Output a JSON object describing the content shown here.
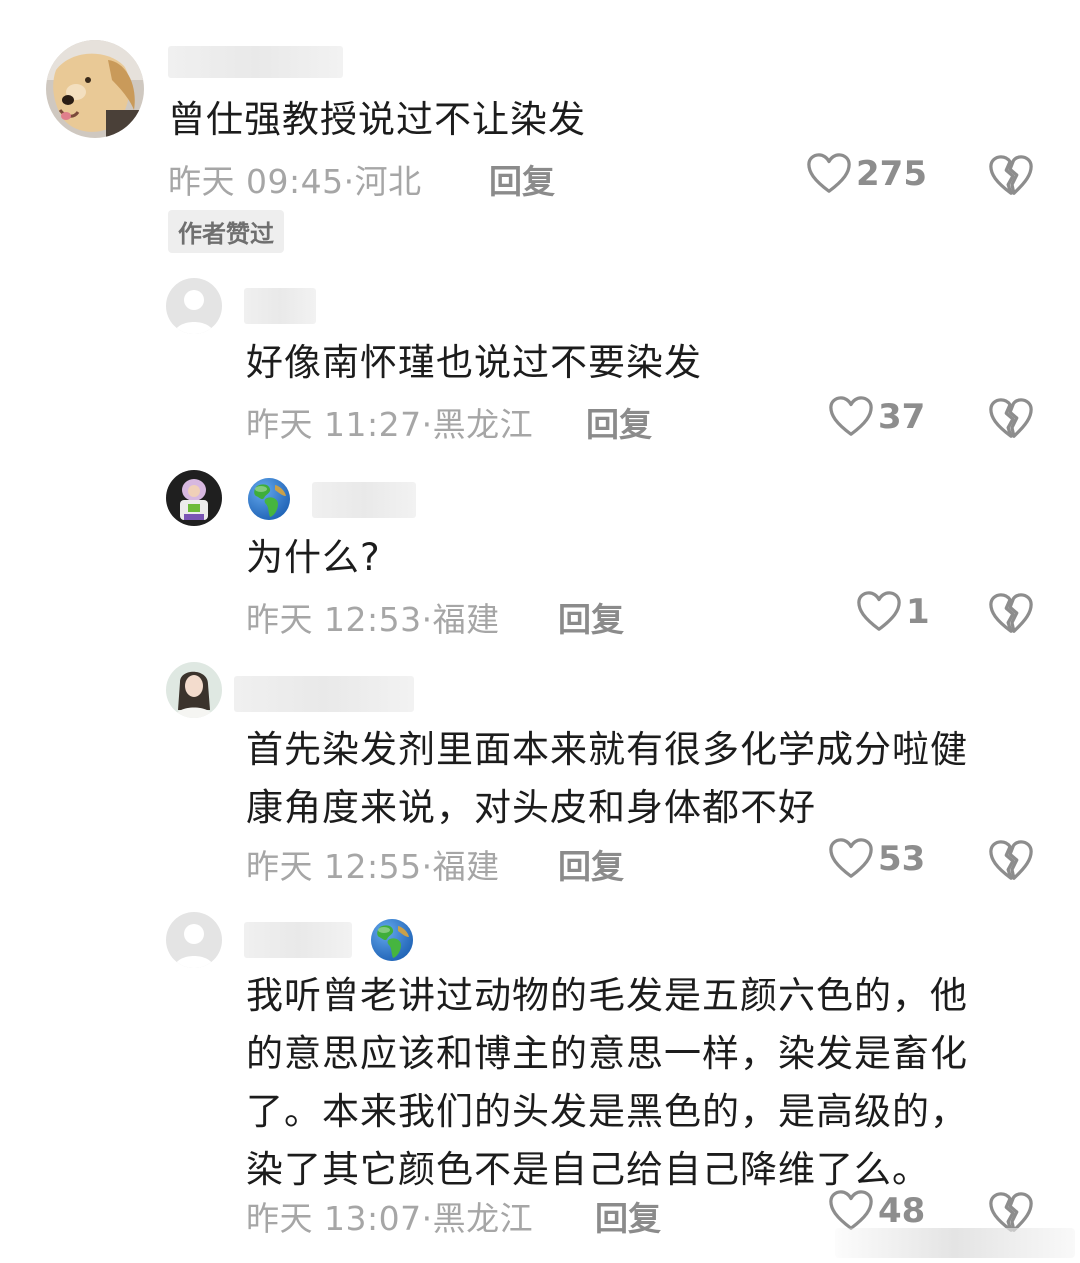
{
  "comments": [
    {
      "content": "曾仕强教授说过不让染发",
      "time": "昨天 09:45",
      "location": "河北",
      "reply_label": "回复",
      "likes": "275",
      "badge": "作者赞过"
    },
    {
      "content": "好像南怀瑾也说过不要染发",
      "time": "昨天 11:27",
      "location": "黑龙江",
      "reply_label": "回复",
      "likes": "37"
    },
    {
      "content": "为什么?",
      "time": "昨天 12:53",
      "location": "福建",
      "reply_label": "回复",
      "likes": "1"
    },
    {
      "content_lines": [
        "首先染发剂里面本来就有很多化学成分啦健",
        "康角度来说，对头皮和身体都不好"
      ],
      "time": "昨天 12:55",
      "location": "福建",
      "reply_label": "回复",
      "likes": "53"
    },
    {
      "content_lines": [
        "我听曾老讲过动物的毛发是五颜六色的，他",
        "的意思应该和博主的意思一样，染发是畜化",
        "了。本来我们的头发是黑色的，是高级的，",
        "染了其它颜色不是自己给自己降维了么。"
      ],
      "time": "昨天 13:07",
      "location": "黑龙江",
      "reply_label": "回复",
      "likes": "48"
    }
  ],
  "separator": "·",
  "icons": {
    "like": "heart-outline-icon",
    "dislike": "broken-heart-icon",
    "region": "globe-icon"
  },
  "colors": {
    "text": "#1c1c1c",
    "meta": "#a6a6a6",
    "icon": "#8d8d8d"
  }
}
